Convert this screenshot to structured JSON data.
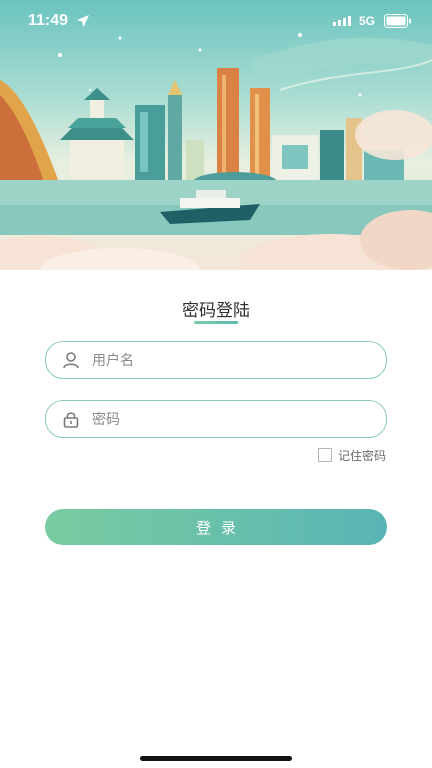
{
  "status_bar": {
    "time": "11:49",
    "network": "5G"
  },
  "login": {
    "title": "密码登陆",
    "username_placeholder": "用户名",
    "password_placeholder": "密码",
    "remember_label": "记住密码",
    "remember_checked": false,
    "submit_label": "登录"
  },
  "colors": {
    "accent_start": "#79cba0",
    "accent_end": "#5ab4b6",
    "field_border": "#8ec9bf"
  },
  "icons": [
    "location-arrow-icon",
    "signal-icon",
    "battery-icon",
    "user-icon",
    "lock-icon"
  ]
}
